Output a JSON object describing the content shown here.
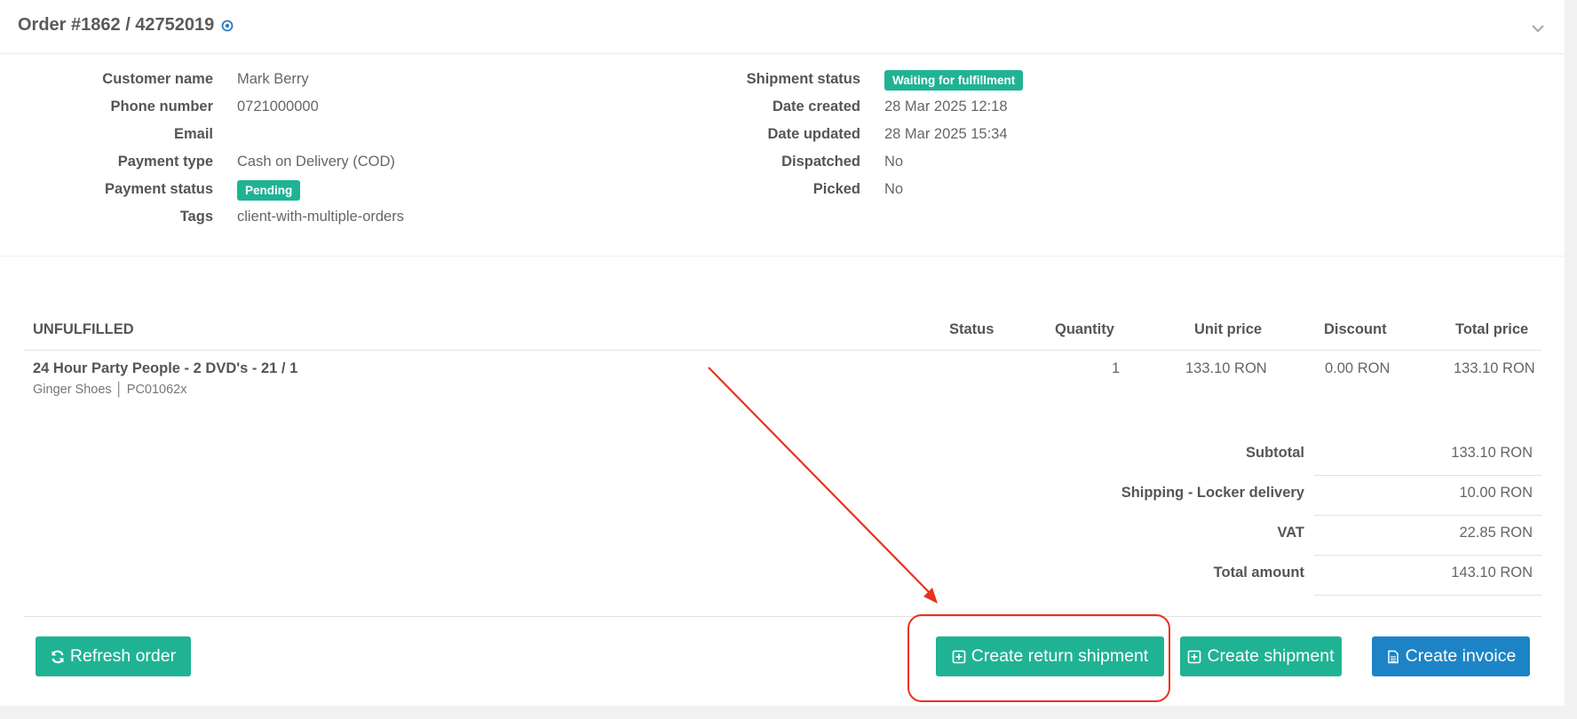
{
  "header": {
    "title": "Order #1862 / 42752019"
  },
  "customer": {
    "name_label": "Customer name",
    "name": "Mark Berry",
    "phone_label": "Phone number",
    "phone": "0721000000",
    "email_label": "Email",
    "email": "",
    "payment_type_label": "Payment type",
    "payment_type": "Cash on Delivery (COD)",
    "payment_status_label": "Payment status",
    "payment_status": "Pending",
    "tags_label": "Tags",
    "tags": "client-with-multiple-orders"
  },
  "shipment": {
    "status_label": "Shipment status",
    "status": "Waiting for fulfillment",
    "created_label": "Date created",
    "created": "28 Mar 2025 12:18",
    "updated_label": "Date updated",
    "updated": "28 Mar 2025 15:34",
    "dispatched_label": "Dispatched",
    "dispatched": "No",
    "picked_label": "Picked",
    "picked": "No"
  },
  "items": {
    "section_title": "UNFULFILLED",
    "columns": {
      "status": "Status",
      "quantity": "Quantity",
      "unit_price": "Unit price",
      "discount": "Discount",
      "total_price": "Total price"
    },
    "rows": [
      {
        "name": "24 Hour Party People - 2 DVD's - 21 / 1",
        "sub": "Ginger Shoes │ PC01062x",
        "status": "",
        "quantity": "1",
        "unit_price": "133.10 RON",
        "discount": "0.00 RON",
        "total_price": "133.10 RON"
      }
    ]
  },
  "totals": [
    {
      "label": "Subtotal",
      "value": "133.10 RON"
    },
    {
      "label": "Shipping - Locker delivery",
      "value": "10.00 RON"
    },
    {
      "label": "VAT",
      "value": "22.85 RON"
    },
    {
      "label": "Total amount",
      "value": "143.10 RON"
    }
  ],
  "actions": {
    "refresh": "Refresh order",
    "create_return": "Create return shipment",
    "create_shipment": "Create shipment",
    "create_invoice": "Create invoice"
  },
  "colors": {
    "badge": "#1fb394",
    "primary_green": "#1fb394",
    "primary_blue": "#1c84c6",
    "annotation_red": "#e8331f"
  }
}
